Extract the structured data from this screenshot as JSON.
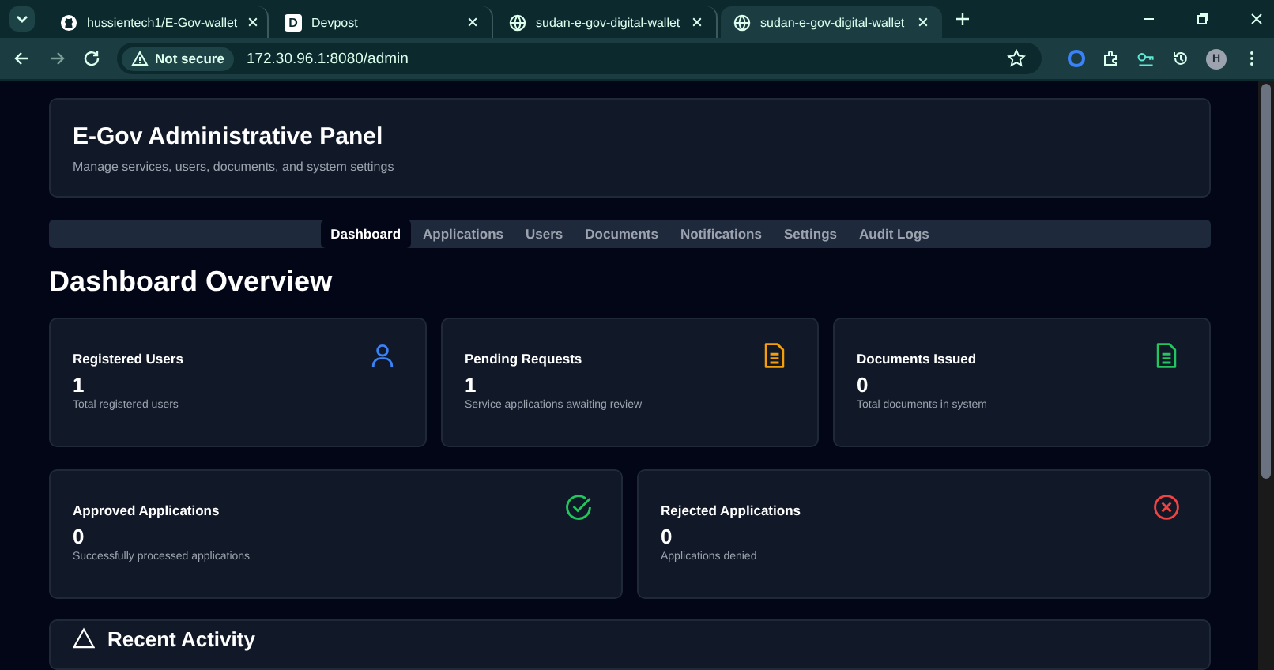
{
  "browser": {
    "tabs": [
      {
        "title": "hussientech1/E-Gov-wallet",
        "kind": "github",
        "selected": false
      },
      {
        "title": "Devpost",
        "kind": "letter",
        "favicon_text": "D",
        "selected": false
      },
      {
        "title": "sudan-e-gov-digital-wallet",
        "kind": "globe",
        "selected": false
      },
      {
        "title": "sudan-e-gov-digital-wallet",
        "kind": "globe",
        "selected": true
      }
    ],
    "security": "Not secure",
    "url": "172.30.96.1:8080/admin",
    "profile": "H"
  },
  "header": {
    "title": "E-Gov Administrative Panel",
    "subtitle": "Manage services, users, documents, and system settings"
  },
  "nav": [
    {
      "label": "Dashboard",
      "selected": true
    },
    {
      "label": "Applications",
      "selected": false
    },
    {
      "label": "Users",
      "selected": false
    },
    {
      "label": "Documents",
      "selected": false
    },
    {
      "label": "Notifications",
      "selected": false
    },
    {
      "label": "Settings",
      "selected": false
    },
    {
      "label": "Audit Logs",
      "selected": false
    }
  ],
  "page_title": "Dashboard Overview",
  "stats": [
    {
      "title": "Registered Users",
      "value": "1",
      "caption": "Total registered users",
      "kind": "user",
      "color": "#3b82f6"
    },
    {
      "title": "Pending Requests",
      "value": "1",
      "caption": "Service applications awaiting review",
      "kind": "document",
      "color": "#f59e0b"
    },
    {
      "title": "Documents Issued",
      "value": "0",
      "caption": "Total documents in system",
      "kind": "document",
      "color": "#22c55e"
    },
    {
      "title": "Approved Applications",
      "value": "0",
      "caption": "Successfully processed applications",
      "kind": "check",
      "color": "#22c55e"
    },
    {
      "title": "Rejected Applications",
      "value": "0",
      "caption": "Applications denied",
      "kind": "cross",
      "color": "#ef4444"
    }
  ],
  "recent": {
    "title": "Recent Activity"
  }
}
